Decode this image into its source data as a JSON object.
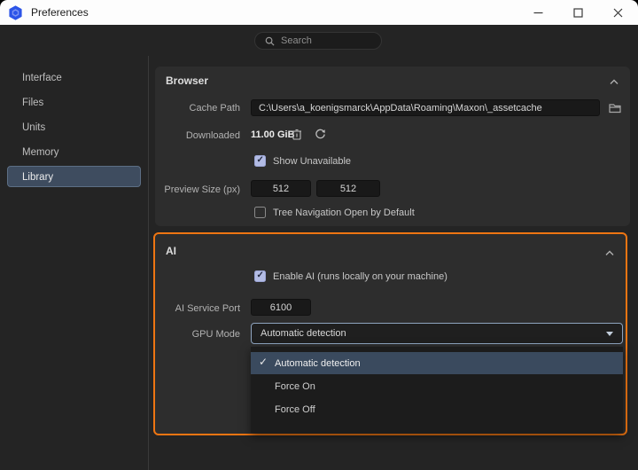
{
  "window": {
    "title": "Preferences"
  },
  "search": {
    "placeholder": "Search"
  },
  "sidebar": {
    "items": [
      {
        "label": "Interface",
        "selected": false
      },
      {
        "label": "Files",
        "selected": false
      },
      {
        "label": "Units",
        "selected": false
      },
      {
        "label": "Memory",
        "selected": false
      },
      {
        "label": "Library",
        "selected": true
      }
    ]
  },
  "browser_section": {
    "title": "Browser",
    "cache_path": {
      "label": "Cache Path",
      "value": "C:\\Users\\a_koenigsmarck\\AppData\\Roaming\\Maxon\\_assetcache"
    },
    "downloaded": {
      "label": "Downloaded",
      "value": "11.00 GiB"
    },
    "show_unavailable": {
      "label": "Show Unavailable",
      "checked": true
    },
    "preview_size": {
      "label": "Preview Size (px)",
      "width": "512",
      "height": "512"
    },
    "tree_navigation": {
      "label": "Tree Navigation Open by Default",
      "checked": false
    }
  },
  "ai_section": {
    "title": "AI",
    "enable_ai": {
      "label": "Enable AI (runs locally on your machine)",
      "checked": true
    },
    "service_port": {
      "label": "AI Service Port",
      "value": "6100"
    },
    "gpu_mode": {
      "label": "GPU Mode",
      "value": "Automatic detection",
      "options": [
        {
          "label": "Automatic detection",
          "selected": true
        },
        {
          "label": "Force On",
          "selected": false
        },
        {
          "label": "Force Off",
          "selected": false
        }
      ]
    }
  },
  "icons": {
    "app_logo": "maxon-hexagon",
    "search": "magnifier",
    "minimize": "–",
    "maximize": "□",
    "close": "✕",
    "collapse": "chevron-up",
    "browse": "folder",
    "delete": "trash",
    "refresh": "circular-arrow",
    "dropdown": "caret-down",
    "selected_option": "✓"
  },
  "colors": {
    "accent_orange": "#ee7512",
    "selection_blue": "#3e4c5f",
    "checkbox_checked": "#b2bbe4",
    "panel_bg": "#2d2d2d",
    "window_bg": "#242424",
    "titlebar_bg": "#fdfdfd",
    "input_bg": "#191919",
    "logo_blue": "#2c55e8"
  }
}
